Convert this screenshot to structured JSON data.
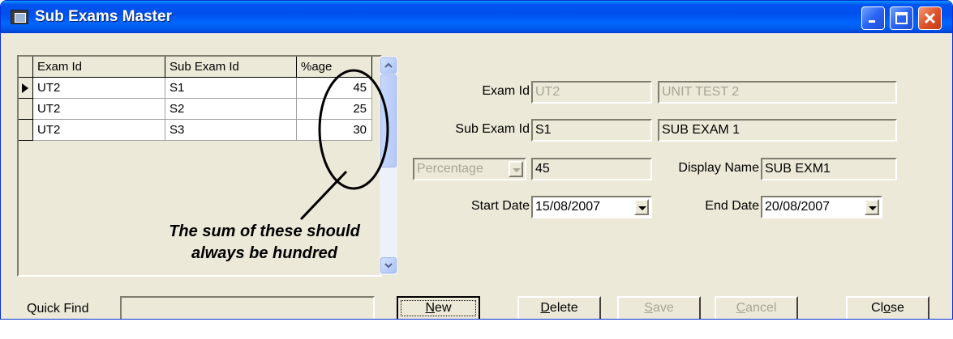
{
  "window": {
    "title": "Sub Exams Master"
  },
  "grid": {
    "columns": [
      "Exam Id",
      "Sub Exam Id",
      "%age"
    ],
    "rows": [
      {
        "exam_id": "UT2",
        "sub_exam_id": "S1",
        "pct": "45"
      },
      {
        "exam_id": "UT2",
        "sub_exam_id": "S2",
        "pct": "25"
      },
      {
        "exam_id": "UT2",
        "sub_exam_id": "S3",
        "pct": "30"
      }
    ],
    "selected_row": 0
  },
  "annotation": {
    "text": "The sum of these should always be hundred"
  },
  "form": {
    "exam_id_label": "Exam Id",
    "exam_id_value": "UT2",
    "exam_name_value": "UNIT TEST 2",
    "sub_exam_id_label": "Sub Exam Id",
    "sub_exam_id_value": "S1",
    "sub_exam_name_value": "SUB EXAM 1",
    "type_select_value": "Percentage",
    "type_value": "45",
    "display_name_label": "Display Name",
    "display_name_value": "SUB EXM1",
    "start_date_label": "Start Date",
    "start_date_value": "15/08/2007",
    "end_date_label": "End Date",
    "end_date_value": "20/08/2007"
  },
  "quick_find": {
    "label": "Quick Find",
    "value": ""
  },
  "buttons": {
    "new": {
      "label_ul": "N",
      "label_rest": "ew"
    },
    "delete": {
      "label_ul": "D",
      "label_rest": "elete"
    },
    "save": {
      "label_ul": "S",
      "label_rest": "ave"
    },
    "cancel": {
      "label_ul": "C",
      "label_rest": "ancel"
    },
    "close": {
      "label_pre": "Cl",
      "label_ul": "o",
      "label_rest": "se"
    }
  },
  "colors": {
    "titlebar": "#0054e3",
    "window_bg": "#ece9d8",
    "disabled_text": "#a8a596"
  }
}
